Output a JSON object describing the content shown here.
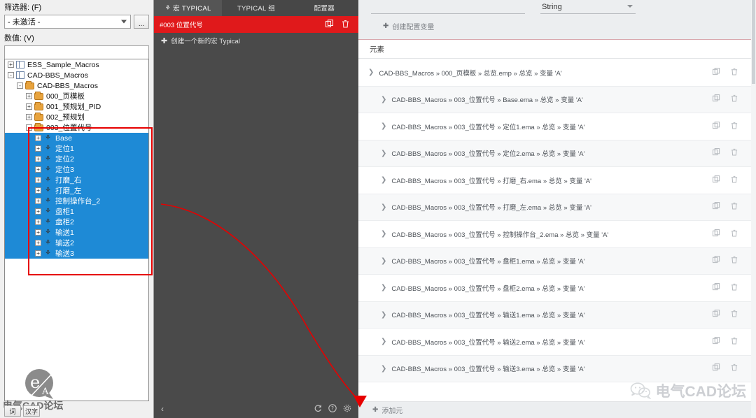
{
  "left": {
    "filter_label": "筛选器: (F)",
    "filter_value": "- 未激活 -",
    "ellipsis_label": "...",
    "value_label": "数值: (V)",
    "value_text": "",
    "tree": [
      {
        "depth": 0,
        "label": "ESS_Sample_Macros",
        "icon": "book-icon",
        "expander": "+",
        "selected": false
      },
      {
        "depth": 0,
        "label": "CAD-BBS_Macros",
        "icon": "book-icon",
        "expander": "-",
        "selected": false
      },
      {
        "depth": 1,
        "label": "CAD-BBS_Macros",
        "icon": "folder-icon",
        "expander": "-",
        "selected": false
      },
      {
        "depth": 2,
        "label": "000_页模板",
        "icon": "folder-icon",
        "expander": "+",
        "selected": false
      },
      {
        "depth": 2,
        "label": "001_预规划_PID",
        "icon": "folder-icon",
        "expander": "+",
        "selected": false
      },
      {
        "depth": 2,
        "label": "002_预规划",
        "icon": "folder-icon",
        "expander": "+",
        "selected": false
      },
      {
        "depth": 2,
        "label": "003_位置代号",
        "icon": "folder-icon",
        "expander": "-",
        "selected": false
      },
      {
        "depth": 3,
        "label": "Base",
        "icon": "macro-icon",
        "expander": "+",
        "selected": true
      },
      {
        "depth": 3,
        "label": "定位1",
        "icon": "macro-icon",
        "expander": "+",
        "selected": true
      },
      {
        "depth": 3,
        "label": "定位2",
        "icon": "macro-icon",
        "expander": "+",
        "selected": true
      },
      {
        "depth": 3,
        "label": "定位3",
        "icon": "macro-icon",
        "expander": "+",
        "selected": true
      },
      {
        "depth": 3,
        "label": "打磨_右",
        "icon": "macro-icon",
        "expander": "+",
        "selected": true
      },
      {
        "depth": 3,
        "label": "打磨_左",
        "icon": "macro-icon",
        "expander": "+",
        "selected": true
      },
      {
        "depth": 3,
        "label": "控制操作台_2",
        "icon": "macro-icon",
        "expander": "+",
        "selected": true
      },
      {
        "depth": 3,
        "label": "盘柜1",
        "icon": "macro-icon",
        "expander": "+",
        "selected": true
      },
      {
        "depth": 3,
        "label": "盘柜2",
        "icon": "macro-icon",
        "expander": "+",
        "selected": true
      },
      {
        "depth": 3,
        "label": "输送1",
        "icon": "macro-icon",
        "expander": "+",
        "selected": true
      },
      {
        "depth": 3,
        "label": "输送2",
        "icon": "macro-icon",
        "expander": "+",
        "selected": true
      },
      {
        "depth": 3,
        "label": "输送3",
        "icon": "macro-icon",
        "expander": "+",
        "selected": true
      }
    ],
    "watermark": "电气CAD论坛",
    "status_cells": [
      "词",
      "汉字"
    ]
  },
  "mid": {
    "tabs": [
      {
        "label": "宏 TYPICAL",
        "icon": "macro-icon",
        "active": true
      },
      {
        "label": "TYPICAL 组",
        "icon": "",
        "active": false
      },
      {
        "label": "配置器",
        "icon": "",
        "active": false
      }
    ],
    "selected_item": "#003 位置代号",
    "copy_icon": "copy-icon",
    "delete_icon": "trash-icon",
    "create_label": "创建一个新的宏 Typical",
    "bottom": {
      "back_icon": "chevron-left-icon",
      "refresh_icon": "refresh-icon",
      "help_icon": "help-icon",
      "settings_icon": "gear-icon"
    }
  },
  "right": {
    "name_value": "",
    "name_placeholder": "",
    "type_value": "String",
    "create_var_label": "创建配置变量",
    "section_title": "元素",
    "rows": [
      {
        "indent": 0,
        "text": "CAD-BBS_Macros » 000_页模板 » 总览.emp » 总览 » 变量 'A'"
      },
      {
        "indent": 1,
        "text": "CAD-BBS_Macros » 003_位置代号 » Base.ema » 总览 » 变量 'A'"
      },
      {
        "indent": 1,
        "text": "CAD-BBS_Macros » 003_位置代号 » 定位1.ema » 总览 » 变量 'A'"
      },
      {
        "indent": 1,
        "text": "CAD-BBS_Macros » 003_位置代号 » 定位2.ema » 总览 » 变量 'A'"
      },
      {
        "indent": 1,
        "text": "CAD-BBS_Macros » 003_位置代号 » 打磨_右.ema » 总览 » 变量 'A'"
      },
      {
        "indent": 1,
        "text": "CAD-BBS_Macros » 003_位置代号 » 打磨_左.ema » 总览 » 变量 'A'"
      },
      {
        "indent": 1,
        "text": "CAD-BBS_Macros » 003_位置代号 » 控制操作台_2.ema » 总览 » 变量 'A'"
      },
      {
        "indent": 1,
        "text": "CAD-BBS_Macros » 003_位置代号 » 盘柜1.ema » 总览 » 变量 'A'"
      },
      {
        "indent": 1,
        "text": "CAD-BBS_Macros » 003_位置代号 » 盘柜2.ema » 总览 » 变量 'A'"
      },
      {
        "indent": 1,
        "text": "CAD-BBS_Macros » 003_位置代号 » 输送1.ema » 总览 » 变量 'A'"
      },
      {
        "indent": 1,
        "text": "CAD-BBS_Macros » 003_位置代号 » 输送2.ema » 总览 » 变量 'A'"
      },
      {
        "indent": 1,
        "text": "CAD-BBS_Macros » 003_位置代号 » 输送3.ema » 总览 » 变量 'A'"
      }
    ],
    "row_copy_icon": "copy-icon",
    "row_delete_icon": "trash-icon",
    "add_label": "添加元",
    "watermark": "电气CAD论坛"
  },
  "colors": {
    "accent_red": "#e0191b",
    "selection_blue": "#1e8ad6",
    "annotation_red": "#e60000",
    "panel_gray": "#4a4a4a"
  }
}
